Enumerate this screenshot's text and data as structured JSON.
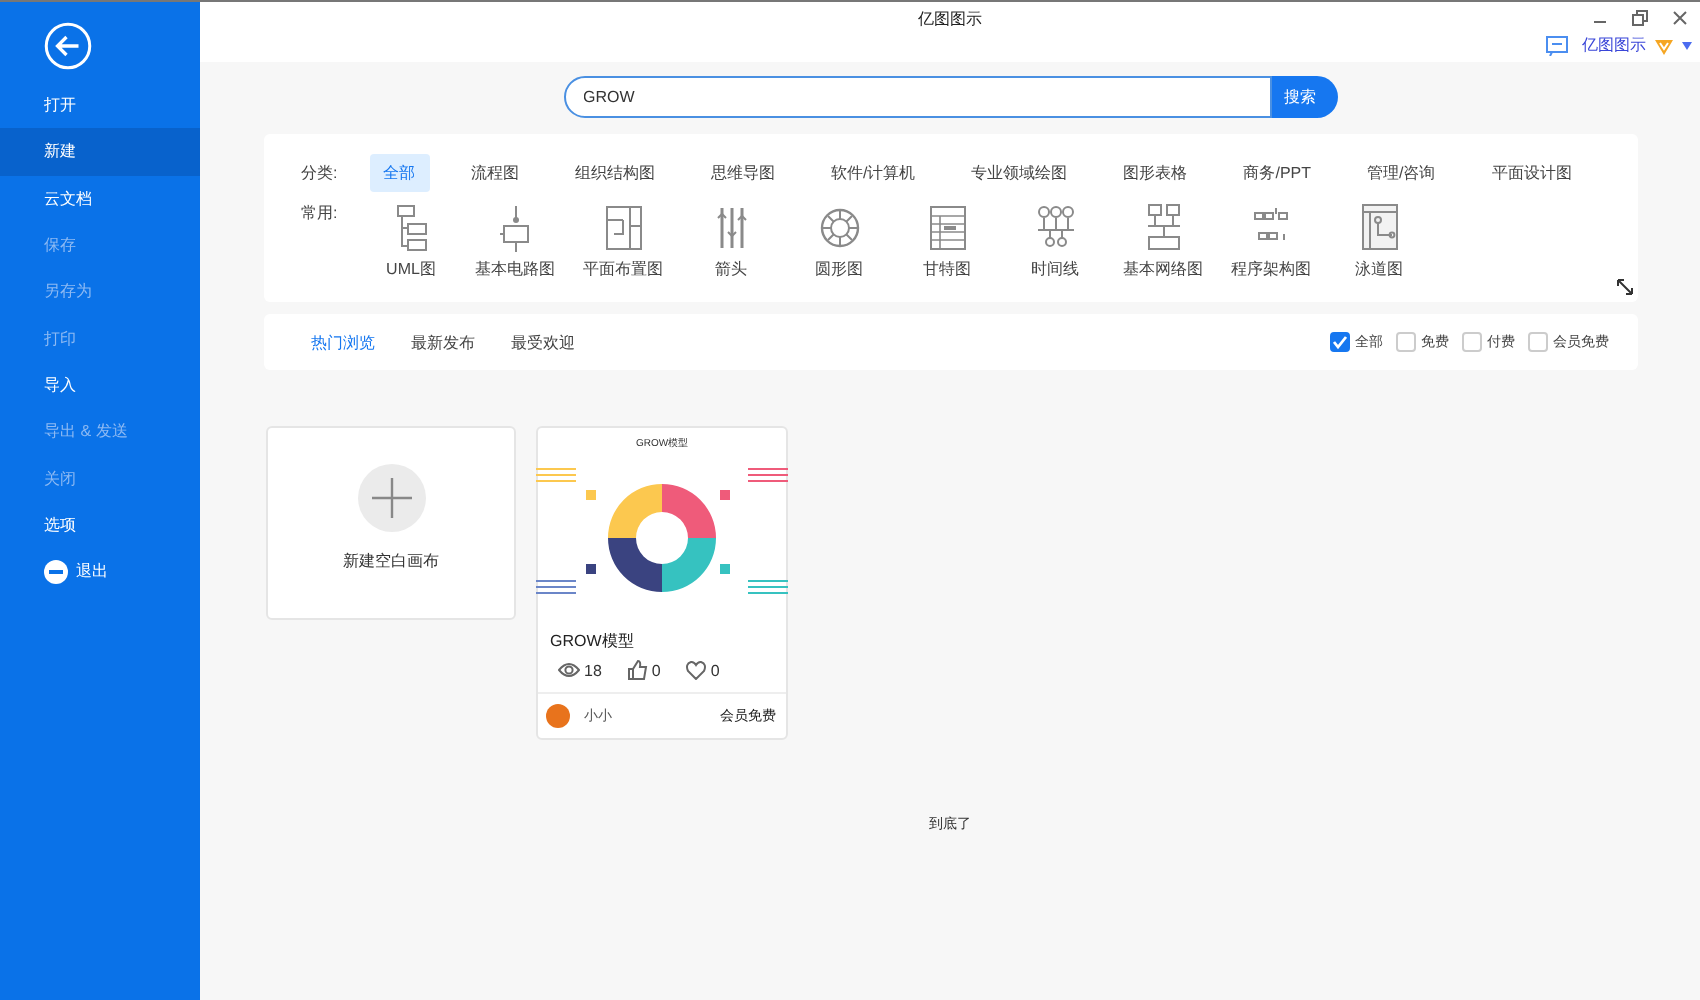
{
  "window": {
    "title": "亿图图示",
    "account": "亿图图示"
  },
  "sidebar": {
    "items": [
      {
        "label": "打开",
        "selected": false,
        "disabled": false
      },
      {
        "label": "新建",
        "selected": true,
        "disabled": false
      },
      {
        "label": "云文档",
        "selected": false,
        "disabled": false
      },
      {
        "label": "保存",
        "selected": false,
        "disabled": true
      },
      {
        "label": "另存为",
        "selected": false,
        "disabled": true
      },
      {
        "label": "打印",
        "selected": false,
        "disabled": true
      },
      {
        "label": "导入",
        "selected": false,
        "disabled": false
      },
      {
        "label": "导出 & 发送",
        "selected": false,
        "disabled": true
      },
      {
        "label": "关闭",
        "selected": false,
        "disabled": true
      },
      {
        "label": "选项",
        "selected": false,
        "disabled": false
      },
      {
        "label": "退出",
        "selected": false,
        "disabled": false,
        "kind": "exit"
      }
    ]
  },
  "search": {
    "value": "GROW",
    "button": "搜索"
  },
  "categories": {
    "label": "分类:",
    "items": [
      {
        "label": "全部",
        "selected": true
      },
      {
        "label": "流程图",
        "selected": false
      },
      {
        "label": "组织结构图",
        "selected": false
      },
      {
        "label": "思维导图",
        "selected": false
      },
      {
        "label": "软件/计算机",
        "selected": false
      },
      {
        "label": "专业领域绘图",
        "selected": false
      },
      {
        "label": "图形表格",
        "selected": false
      },
      {
        "label": "商务/PPT",
        "selected": false
      },
      {
        "label": "管理/咨询",
        "selected": false
      },
      {
        "label": "平面设计图",
        "selected": false
      }
    ]
  },
  "common": {
    "label": "常用:",
    "items": [
      {
        "label": "UML图",
        "kind": "uml"
      },
      {
        "label": "基本电路图",
        "kind": "circuit"
      },
      {
        "label": "平面布置图",
        "kind": "plan"
      },
      {
        "label": "箭头",
        "kind": "arrows"
      },
      {
        "label": "圆形图",
        "kind": "ring"
      },
      {
        "label": "甘特图",
        "kind": "gantt"
      },
      {
        "label": "时间线",
        "kind": "timeline"
      },
      {
        "label": "基本网络图",
        "kind": "network"
      },
      {
        "label": "程序架构图",
        "kind": "blocks"
      },
      {
        "label": "泳道图",
        "kind": "swimlane"
      }
    ]
  },
  "sort_tabs": [
    {
      "label": "热门浏览",
      "selected": true
    },
    {
      "label": "最新发布",
      "selected": false
    },
    {
      "label": "最受欢迎",
      "selected": false
    }
  ],
  "filters": [
    {
      "label": "全部",
      "checked": true
    },
    {
      "label": "免费",
      "checked": false
    },
    {
      "label": "付费",
      "checked": false
    },
    {
      "label": "会员免费",
      "checked": false
    }
  ],
  "new_card": {
    "label": "新建空白画布"
  },
  "templates": [
    {
      "thumbnail_title": "GROW模型",
      "title": "GROW模型",
      "views": "18",
      "likes": "0",
      "favorites": "0",
      "author": "小小",
      "price": "会员免费"
    }
  ],
  "footer": "到底了"
}
